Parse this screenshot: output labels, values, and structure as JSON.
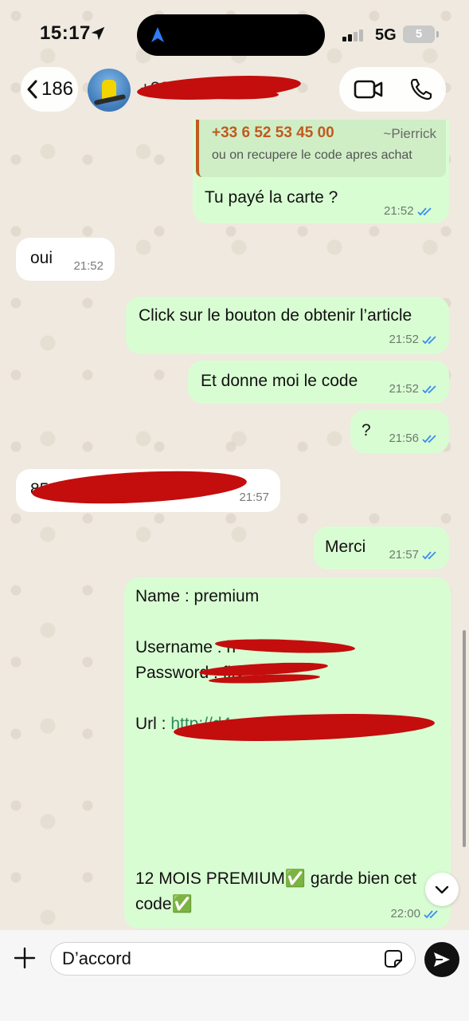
{
  "status_bar": {
    "time": "15:17",
    "network": "5G",
    "battery": "5"
  },
  "header": {
    "back_count": "186",
    "contact_name": "+33 ..... 00"
  },
  "quoted": {
    "phone": "+33 6 52 53 45 00",
    "author": "~Pierrick",
    "text": "ou on recupere le code apres achat"
  },
  "messages": [
    {
      "dir": "out",
      "text": "Tu payé la carte ?",
      "time": "21:52"
    },
    {
      "dir": "in",
      "text": "oui",
      "time": "21:52"
    },
    {
      "dir": "out",
      "text": "Click sur le bouton de obtenir l’article",
      "time": "21:52"
    },
    {
      "dir": "out",
      "text": "Et donne moi le code",
      "time": "21:52"
    },
    {
      "dir": "out",
      "text": "?",
      "time": "21:56"
    },
    {
      "dir": "in",
      "text": "85",
      "time": "21:57"
    },
    {
      "dir": "out",
      "text": "Merci",
      "time": "21:57"
    },
    {
      "dir": "out",
      "time": "22:00"
    }
  ],
  "credentials": {
    "name_line": "Name : premium",
    "username_line": "Username : h",
    "password_line": "Password : flfy",
    "url_label": "Url  : ",
    "url_value": "http://d4",
    "footer_line1": "12 MOIS PREMIUM✅ garde bien cet",
    "footer_line2": "code✅"
  },
  "input": {
    "value": "D’accord"
  },
  "colors": {
    "outgoing_bubble": "#d9fdd3",
    "incoming_bubble": "#ffffff",
    "read_ticks": "#3b8df0",
    "quote_accent": "#c2591f",
    "redaction": "#c40d0d"
  },
  "icons": {
    "back": "chevron-left-icon",
    "video": "video-camera-icon",
    "phone": "phone-icon",
    "plus": "plus-icon",
    "sticker": "sticker-icon",
    "send": "send-arrow-icon",
    "scroll_down": "chevron-down-icon"
  }
}
